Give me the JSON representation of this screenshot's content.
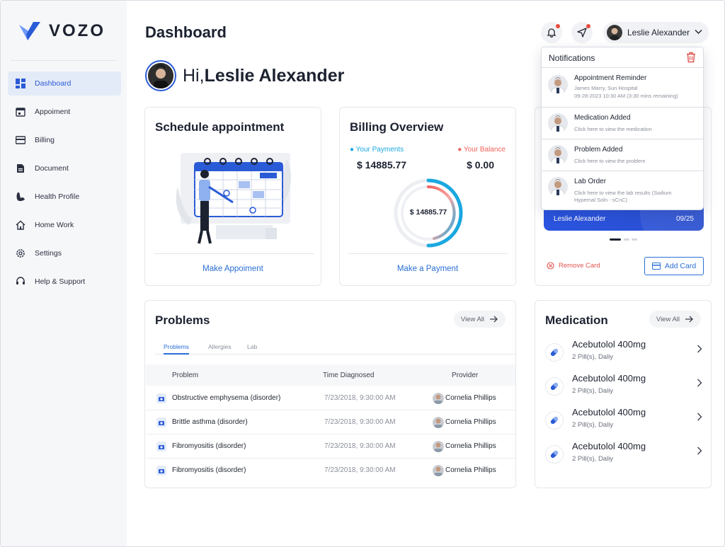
{
  "app": {
    "brand": "vozo",
    "brand_color": "#2a5bd7"
  },
  "sidebar": {
    "items": [
      {
        "label": "Dashboard",
        "icon": "dashboard-icon",
        "active": true
      },
      {
        "label": "Appoiment",
        "icon": "calendar-icon"
      },
      {
        "label": "Billing",
        "icon": "credit-card-icon"
      },
      {
        "label": "Document",
        "icon": "document-icon"
      },
      {
        "label": "Health Profile",
        "icon": "muscle-icon"
      },
      {
        "label": "Home Work",
        "icon": "home-icon"
      },
      {
        "label": "Settings",
        "icon": "gear-icon"
      },
      {
        "label": "Help & Support",
        "icon": "headset-icon"
      }
    ]
  },
  "header": {
    "title": "Dashboard",
    "user_name": "Leslie Alexander"
  },
  "greeting": {
    "prefix": "Hi,",
    "name": "Leslie Alexander"
  },
  "schedule": {
    "title": "Schedule appointment",
    "link": "Make Appoiment"
  },
  "billing": {
    "title": "Billing Overview",
    "payments_label": "Your Payments",
    "payments_value": "$ 14885.77",
    "balance_label": "Your Balance",
    "balance_value": "$ 0.00",
    "ring_value": "$ 14885.77",
    "link": "Make a Payment",
    "payments_color": "#1aa8e0",
    "balance_color": "#f0625c"
  },
  "payment_card": {
    "holder": "Leslie Alexander",
    "expiry": "09/25",
    "remove_label": "Remove Card",
    "add_label": "Add Card"
  },
  "problems": {
    "title": "Problems",
    "view_all": "View All",
    "tabs": [
      "Problems",
      "Allergies",
      "Lab"
    ],
    "columns": [
      "Problem",
      "Time Diagnosed",
      "Provider"
    ],
    "rows": [
      {
        "problem": "Obstructive emphysema (disorder)",
        "time": "7/23/2018, 9:30:00 AM",
        "provider": "Cornelia Phillips"
      },
      {
        "problem": "Brittle asthma (disorder)",
        "time": "7/23/2018, 9:30:00 AM",
        "provider": "Cornelia Phillips"
      },
      {
        "problem": "Fibromyositis (disorder)",
        "time": "7/23/2018, 9:30:00 AM",
        "provider": "Cornelia Phillips"
      },
      {
        "problem": "Fibromyositis (disorder)",
        "time": "7/23/2018, 9:30:00 AM",
        "provider": "Cornelia Phillips"
      }
    ]
  },
  "medication": {
    "title": "Medication",
    "view_all": "View All",
    "items": [
      {
        "name": "Acebutolol 400mg",
        "dose": "2 Pill(s), Daliy"
      },
      {
        "name": "Acebutolol 400mg",
        "dose": "2 Pill(s), Daliy"
      },
      {
        "name": "Acebutolol 400mg",
        "dose": "2 Pill(s), Daliy"
      },
      {
        "name": "Acebutolol 400mg",
        "dose": "2 Pill(s), Daliy"
      }
    ]
  },
  "notifications": {
    "title": "Notifications",
    "items": [
      {
        "title": "Appointment Reminder",
        "line1": "James Marry, Sun Hospital",
        "line2": "09-28-2023 10:30 AM  (3:30 mins remaining)"
      },
      {
        "title": "Medication Added",
        "line1": "Click here to view the medication",
        "line2": ""
      },
      {
        "title": "Problem Added",
        "line1": "Click here to view the problem",
        "line2": ""
      },
      {
        "title": "Lab Order",
        "line1": "Click here to view the lab results (Sodium",
        "line2": "Hypernal Soln - sCnC)"
      }
    ]
  }
}
